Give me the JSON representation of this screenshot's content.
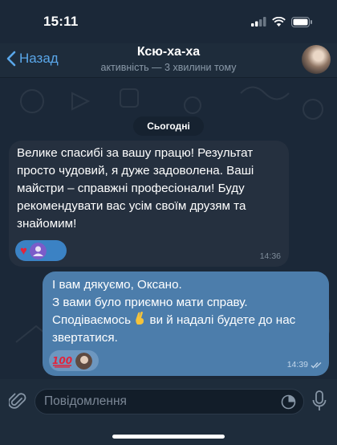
{
  "status_bar": {
    "time": "15:11"
  },
  "header": {
    "back_label": "Назад",
    "title": "Ксю-ха-ха",
    "subtitle": "активність — 3 хвилини тому"
  },
  "date_separator": "Сьогодні",
  "messages": [
    {
      "direction": "incoming",
      "text": "Велике спасибі за вашу працю! Результат просто чудовий, я дуже задоволена. Ваші майстри – справжні професіонали! Буду рекомендувати вас усім своїм друзям та знайомим!",
      "time": "14:36",
      "reactions": [
        "red-heart",
        "sender-avatar"
      ]
    },
    {
      "direction": "outgoing",
      "lines": [
        "І вам дякуємо, Оксано.",
        "З вами було приємно мати справу.",
        "Сподіваємось",
        "ви й надалі будете до нас",
        "звертатися."
      ],
      "time": "14:39",
      "read": true,
      "reactions": [
        "hundred-points",
        "recipient-avatar"
      ]
    }
  ],
  "composer": {
    "placeholder": "Повідомлення"
  },
  "colors": {
    "background": "#1b2838",
    "incoming_bubble": "#25303f",
    "outgoing_bubble": "#4c7dab",
    "accent": "#5aa7ea"
  }
}
